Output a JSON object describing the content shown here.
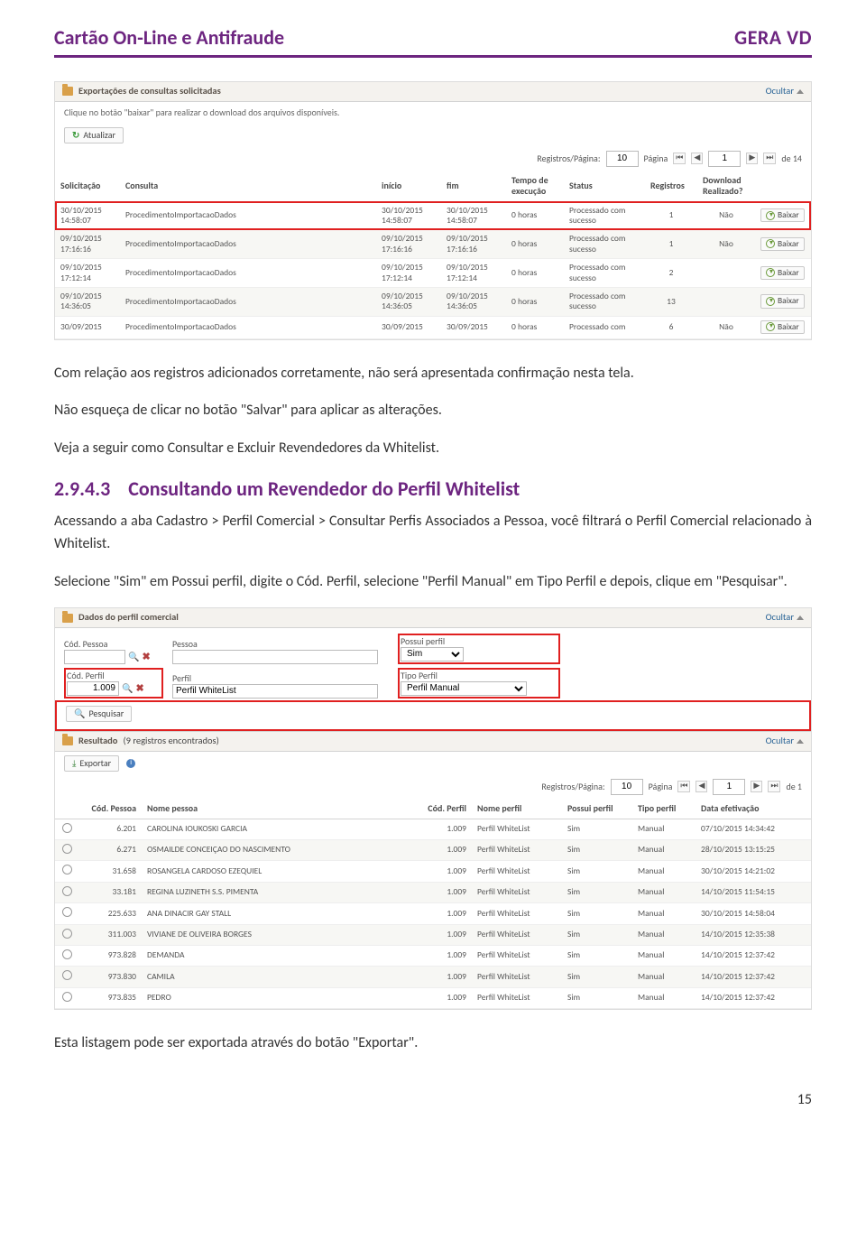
{
  "header": {
    "title": "Cartão On-Line e Antifraude",
    "brand": "GERA VD"
  },
  "shot1": {
    "panel_title": "Exportações de consultas solicitadas",
    "hide": "Ocultar",
    "hint": "Clique no botão \"baixar\" para realizar o download dos arquivos disponíveis.",
    "refresh": "Atualizar",
    "pager": {
      "label_rpp": "Registros/Página:",
      "rpp": "10",
      "label_page": "Página",
      "page": "1",
      "of": "de 14"
    },
    "cols": {
      "sol": "Solicitação",
      "cons": "Consulta",
      "ini": "início",
      "fim": "fim",
      "tempo": "Tempo de execução",
      "status": "Status",
      "reg": "Registros",
      "dlreal": "Download Realizado?",
      "act": ""
    },
    "baixar": "Baixar",
    "nao": "Não",
    "rows": [
      {
        "sol": "30/10/2015 14:58:07",
        "cons": "ProcedimentoImportacaoDados",
        "ini": "30/10/2015 14:58:07",
        "fim": "30/10/2015 14:58:07",
        "tempo": "0 horas",
        "status": "Processado com sucesso",
        "reg": "1",
        "dlreal": "Não",
        "hl": true
      },
      {
        "sol": "09/10/2015 17:16:16",
        "cons": "ProcedimentoImportacaoDados",
        "ini": "09/10/2015 17:16:16",
        "fim": "09/10/2015 17:16:16",
        "tempo": "0 horas",
        "status": "Processado com sucesso",
        "reg": "1",
        "dlreal": "Não"
      },
      {
        "sol": "09/10/2015 17:12:14",
        "cons": "ProcedimentoImportacaoDados",
        "ini": "09/10/2015 17:12:14",
        "fim": "09/10/2015 17:12:14",
        "tempo": "0 horas",
        "status": "Processado com sucesso",
        "reg": "2",
        "dlreal": ""
      },
      {
        "sol": "09/10/2015 14:36:05",
        "cons": "ProcedimentoImportacaoDados",
        "ini": "09/10/2015 14:36:05",
        "fim": "09/10/2015 14:36:05",
        "tempo": "0 horas",
        "status": "Processado com sucesso",
        "reg": "13",
        "dlreal": ""
      },
      {
        "sol": "30/09/2015",
        "cons": "ProcedimentoImportacaoDados",
        "ini": "30/09/2015",
        "fim": "30/09/2015",
        "tempo": "0 horas",
        "status": "Processado com",
        "reg": "6",
        "dlreal": "Não"
      }
    ]
  },
  "body": {
    "p1": "Com relação aos registros adicionados corretamente, não será apresentada confirmação nesta tela.",
    "p2": "Não esqueça de clicar no botão \"Salvar\" para aplicar as alterações.",
    "p3": "Veja a seguir como Consultar e Excluir Revendedores da Whitelist.",
    "sec_num": "2.9.4.3",
    "sec_title": "Consultando um Revendedor do Perfil Whitelist",
    "p4": "Acessando a aba Cadastro > Perfil Comercial > Consultar Perfis Associados a Pessoa, você filtrará o Perfil Comercial relacionado à Whitelist.",
    "p5": "Selecione \"Sim\" em Possui perfil, digite o Cód. Perfil, selecione \"Perfil Manual\" em Tipo Perfil e depois, clique em \"Pesquisar\".",
    "p6": "Esta listagem pode ser exportada através do botão \"Exportar\"."
  },
  "shot2": {
    "panel_title": "Dados do perfil comercial",
    "hide": "Ocultar",
    "labels": {
      "cod_pessoa": "Cód. Pessoa",
      "pessoa": "Pessoa",
      "possui": "Possui perfil",
      "cod_perfil": "Cód. Perfil",
      "perfil": "Perfil",
      "tipo": "Tipo Perfil"
    },
    "values": {
      "cod_pessoa": "",
      "pessoa": "",
      "possui": "Sim",
      "cod_perfil": "1.009",
      "perfil": "Perfil WhiteList",
      "tipo": "Perfil Manual"
    },
    "search_btn": "Pesquisar",
    "result_title": "Resultado",
    "result_count": "(9 registros encontrados)",
    "export": "Exportar",
    "pager": {
      "label_rpp": "Registros/Página:",
      "rpp": "10",
      "label_page": "Página",
      "page": "1",
      "of": "de 1"
    },
    "cols": {
      "sel": "",
      "cp": "Cód. Pessoa",
      "np": "Nome pessoa",
      "cperf": "Cód. Perfil",
      "nperf": "Nome perfil",
      "pos": "Possui perfil",
      "tp": "Tipo perfil",
      "dt": "Data efetivação"
    },
    "rows": [
      {
        "cp": "6.201",
        "np": "CAROLINA IOUKOSKI GARCIA",
        "cperf": "1.009",
        "nperf": "Perfil WhiteList",
        "pos": "Sim",
        "tp": "Manual",
        "dt": "07/10/2015 14:34:42"
      },
      {
        "cp": "6.271",
        "np": "OSMAILDE CONCEIÇAO DO NASCIMENTO",
        "cperf": "1.009",
        "nperf": "Perfil WhiteList",
        "pos": "Sim",
        "tp": "Manual",
        "dt": "28/10/2015 13:15:25"
      },
      {
        "cp": "31.658",
        "np": "ROSANGELA CARDOSO EZEQUIEL",
        "cperf": "1.009",
        "nperf": "Perfil WhiteList",
        "pos": "Sim",
        "tp": "Manual",
        "dt": "30/10/2015 14:21:02"
      },
      {
        "cp": "33.181",
        "np": "REGINA LUZINETH S.S. PIMENTA",
        "cperf": "1.009",
        "nperf": "Perfil WhiteList",
        "pos": "Sim",
        "tp": "Manual",
        "dt": "14/10/2015 11:54:15"
      },
      {
        "cp": "225.633",
        "np": "ANA DINACIR GAY STALL",
        "cperf": "1.009",
        "nperf": "Perfil WhiteList",
        "pos": "Sim",
        "tp": "Manual",
        "dt": "30/10/2015 14:58:04"
      },
      {
        "cp": "311.003",
        "np": "VIVIANE DE OLIVEIRA BORGES",
        "cperf": "1.009",
        "nperf": "Perfil WhiteList",
        "pos": "Sim",
        "tp": "Manual",
        "dt": "14/10/2015 12:35:38"
      },
      {
        "cp": "973.828",
        "np": "DEMANDA",
        "cperf": "1.009",
        "nperf": "Perfil WhiteList",
        "pos": "Sim",
        "tp": "Manual",
        "dt": "14/10/2015 12:37:42"
      },
      {
        "cp": "973.830",
        "np": "CAMILA",
        "cperf": "1.009",
        "nperf": "Perfil WhiteList",
        "pos": "Sim",
        "tp": "Manual",
        "dt": "14/10/2015 12:37:42"
      },
      {
        "cp": "973.835",
        "np": "PEDRO",
        "cperf": "1.009",
        "nperf": "Perfil WhiteList",
        "pos": "Sim",
        "tp": "Manual",
        "dt": "14/10/2015 12:37:42"
      }
    ]
  },
  "footer": {
    "page_num": "15"
  }
}
